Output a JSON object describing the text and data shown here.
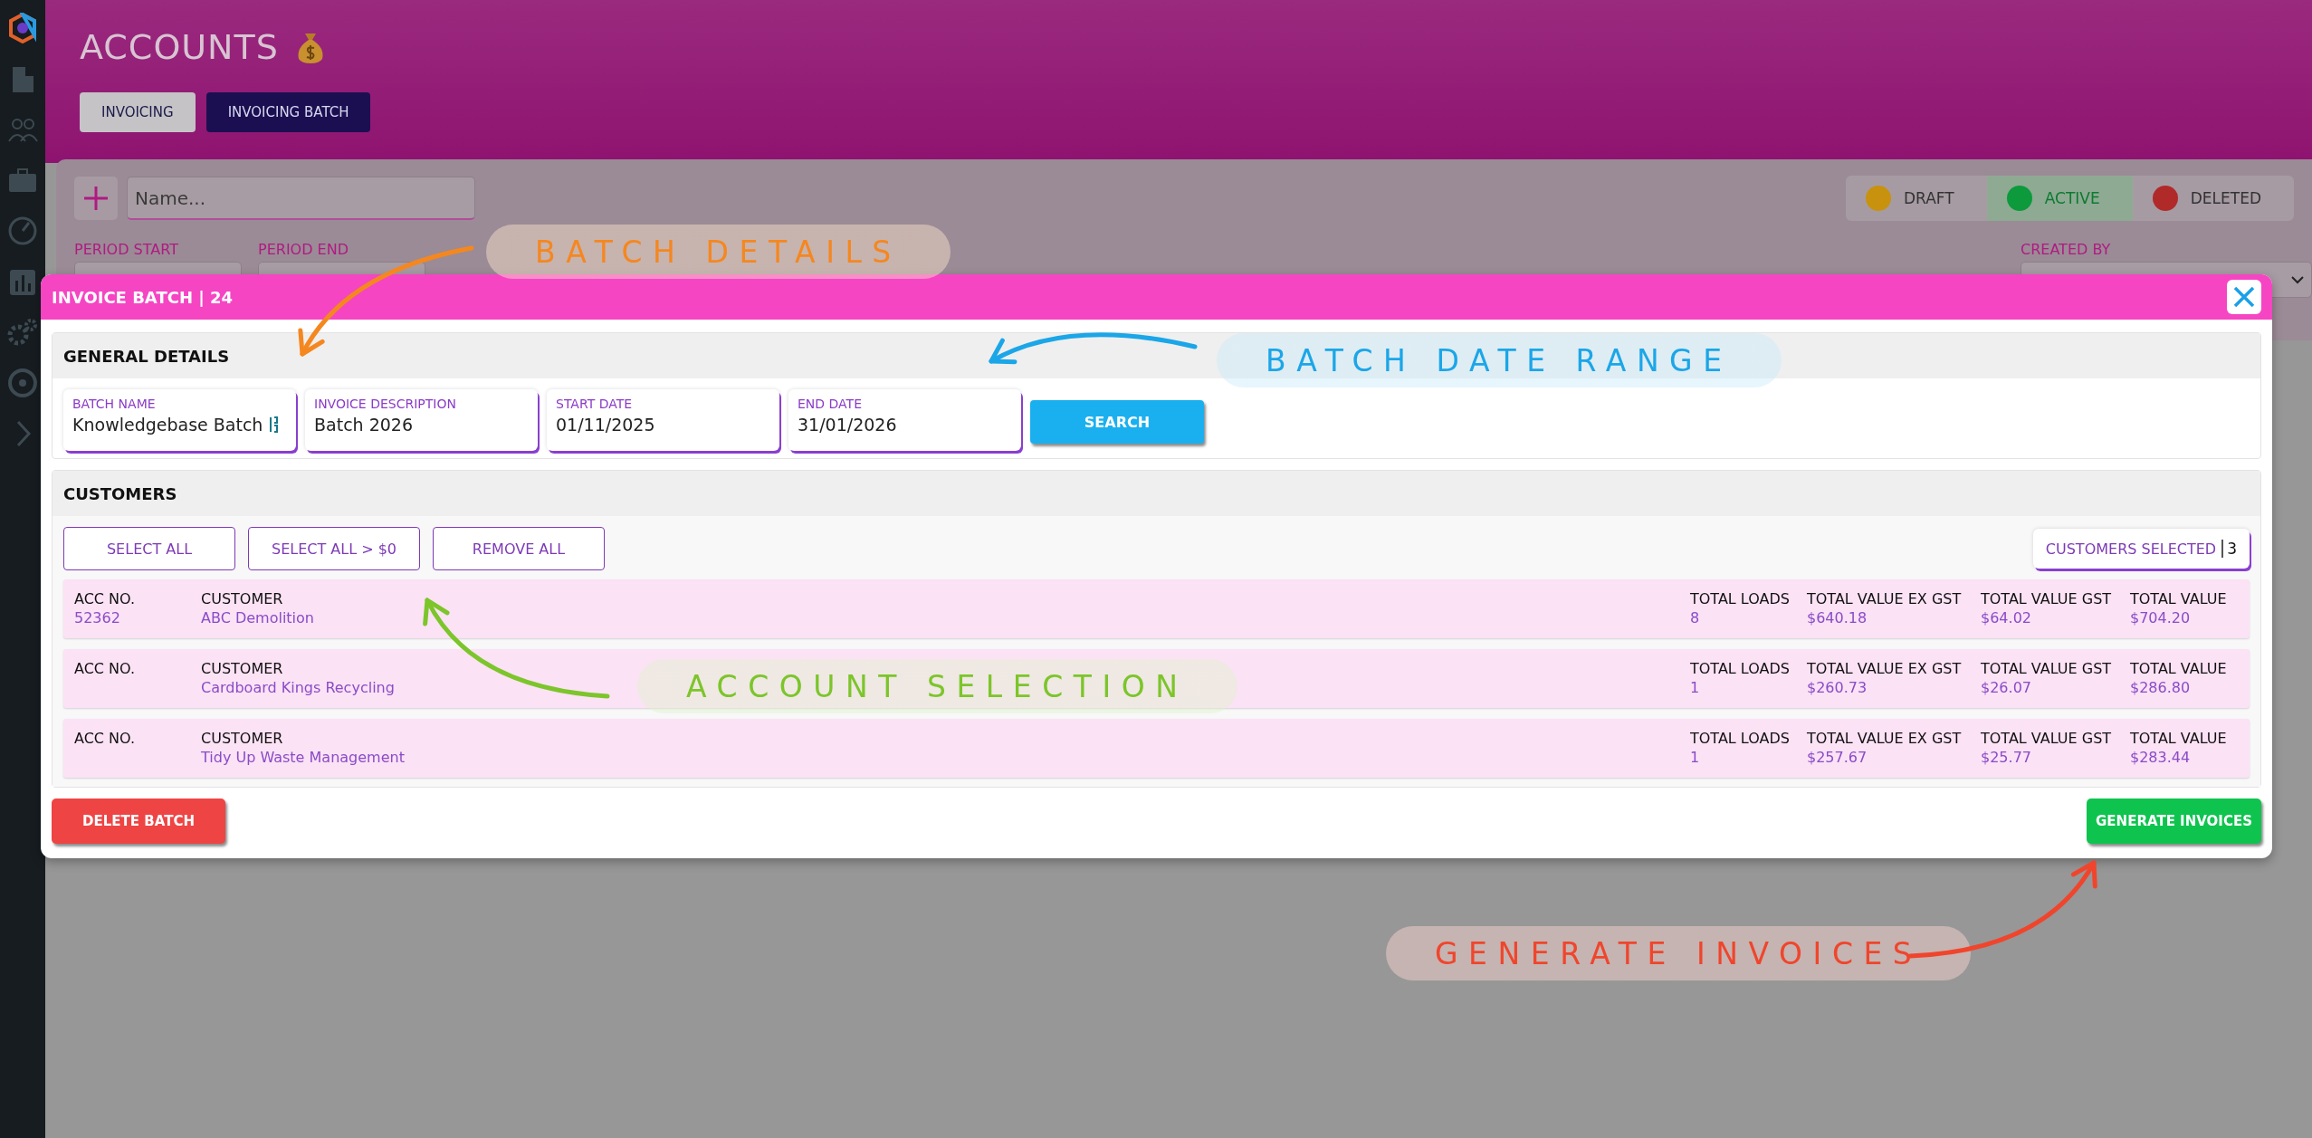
{
  "page": {
    "title": "ACCOUNTS",
    "tabs": [
      {
        "label": "INVOICING",
        "selected": false
      },
      {
        "label": "INVOICING BATCH",
        "selected": true
      }
    ]
  },
  "filters": {
    "name_placeholder": "Name...",
    "statuses": [
      {
        "label": "DRAFT",
        "color": "#c8920f",
        "selected": false
      },
      {
        "label": "ACTIVE",
        "color": "#0c9a3c",
        "selected": true
      },
      {
        "label": "DELETED",
        "color": "#b02a2a",
        "selected": false
      }
    ],
    "period_start_label": "PERIOD START",
    "period_end_label": "PERIOD END",
    "created_by_label": "CREATED BY"
  },
  "modal": {
    "title": "INVOICE BATCH | 24",
    "general": {
      "title": "GENERAL DETAILS",
      "fields": [
        {
          "label": "BATCH NAME",
          "value": "Knowledgebase Batch"
        },
        {
          "label": "INVOICE DESCRIPTION",
          "value": "Batch 2026"
        },
        {
          "label": "START DATE",
          "value": "01/11/2025"
        },
        {
          "label": "END DATE",
          "value": "31/01/2026"
        }
      ],
      "search_button": "SEARCH"
    },
    "customers": {
      "title": "CUSTOMERS",
      "buttons": [
        "SELECT ALL",
        "SELECT ALL > $0",
        "REMOVE ALL"
      ],
      "selected_label": "CUSTOMERS SELECTED",
      "selected_count": "3",
      "rows": [
        {
          "acc_label": "ACC NO.",
          "acc_no": "52362",
          "customer_label": "CUSTOMER",
          "customer": "ABC Demolition",
          "loads_label": "TOTAL LOADS",
          "loads": "8",
          "ex_gst_label": "TOTAL VALUE EX GST",
          "ex_gst": "$640.18",
          "gst_label": "TOTAL VALUE GST",
          "gst": "$64.02",
          "total_label": "TOTAL VALUE",
          "total": "$704.20"
        },
        {
          "acc_label": "ACC NO.",
          "customer_label": "CUSTOMER",
          "customer": "Cardboard Kings Recycling",
          "loads_label": "TOTAL LOADS",
          "loads": "1",
          "ex_gst_label": "TOTAL VALUE EX GST",
          "ex_gst": "$260.73",
          "gst_label": "TOTAL VALUE GST",
          "gst": "$26.07",
          "total_label": "TOTAL VALUE",
          "total": "$286.80"
        },
        {
          "acc_label": "ACC NO.",
          "customer_label": "CUSTOMER",
          "customer": "Tidy Up Waste Management",
          "loads_label": "TOTAL LOADS",
          "loads": "1",
          "ex_gst_label": "TOTAL VALUE EX GST",
          "ex_gst": "$257.67",
          "gst_label": "TOTAL VALUE GST",
          "gst": "$25.77",
          "total_label": "TOTAL VALUE",
          "total": "$283.44"
        }
      ]
    },
    "delete_button": "DELETE BATCH",
    "generate_button": "GENERATE INVOICES"
  },
  "annotations": [
    {
      "text": "BATCH DETAILS",
      "color": "#f5871f"
    },
    {
      "text": "BATCH DATE RANGE",
      "color": "#1ba6e8"
    },
    {
      "text": "ACCOUNT SELECTION",
      "color": "#7cc52a"
    },
    {
      "text": "GENERATE INVOICES",
      "color": "#f0452c"
    }
  ]
}
